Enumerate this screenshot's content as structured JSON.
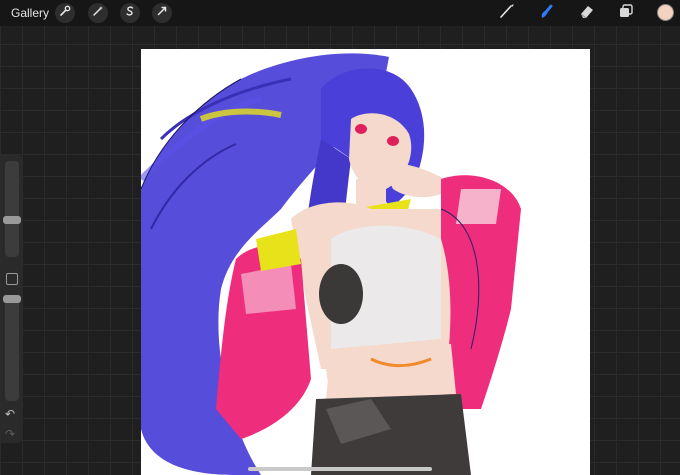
{
  "topbar": {
    "gallery_label": "Gallery",
    "left_tools": [
      {
        "icon": "wrench-icon"
      },
      {
        "icon": "magic-wand-icon"
      },
      {
        "icon": "selection-s-icon"
      },
      {
        "icon": "transform-arrow-icon"
      }
    ],
    "right_tools": [
      {
        "icon": "brush-icon",
        "active": false
      },
      {
        "icon": "smudge-icon",
        "active": true
      },
      {
        "icon": "eraser-icon",
        "active": false
      },
      {
        "icon": "layers-icon",
        "active": false
      }
    ],
    "active_color": "#f2d2c0",
    "accent_color": "#2d7cf6"
  },
  "sidebar": {
    "brush_size_level": 0.38,
    "opacity_level": 0.0,
    "undo_symbol": "↶",
    "redo_symbol": "↷"
  },
  "canvas": {
    "background": "#ffffff",
    "palette": {
      "hair": "#4a3fd8",
      "jacket": "#ee2d7d",
      "skin": "#f4d9cc",
      "collar": "#e8e21a",
      "shorts": "#3f3b3b"
    }
  }
}
